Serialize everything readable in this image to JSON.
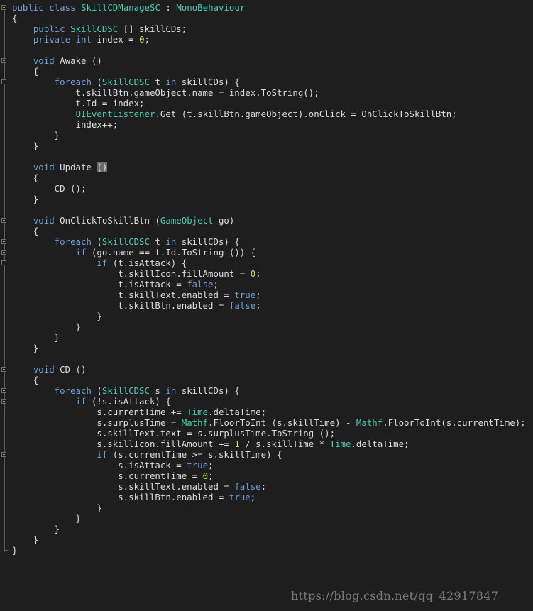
{
  "code_lines": [
    [
      [
        "kw",
        "public"
      ],
      [
        "t",
        " "
      ],
      [
        "kw",
        "class"
      ],
      [
        "t",
        " "
      ],
      [
        "ty",
        "SkillCDManageSC"
      ],
      [
        "t",
        " : "
      ],
      [
        "ty",
        "MonoBehaviour"
      ]
    ],
    [
      [
        "t",
        "{"
      ]
    ],
    [
      [
        "t",
        "    "
      ],
      [
        "kw",
        "public"
      ],
      [
        "t",
        " "
      ],
      [
        "ty",
        "SkillCDSC"
      ],
      [
        "t",
        " [] skillCDs;"
      ]
    ],
    [
      [
        "t",
        "    "
      ],
      [
        "kw",
        "private"
      ],
      [
        "t",
        " "
      ],
      [
        "kw",
        "int"
      ],
      [
        "t",
        " index = "
      ],
      [
        "num",
        "0"
      ],
      [
        "t",
        ";"
      ]
    ],
    [],
    [
      [
        "t",
        "    "
      ],
      [
        "kw",
        "void"
      ],
      [
        "t",
        " Awake ()"
      ]
    ],
    [
      [
        "t",
        "    {"
      ]
    ],
    [
      [
        "t",
        "        "
      ],
      [
        "kw",
        "foreach"
      ],
      [
        "t",
        " ("
      ],
      [
        "ty",
        "SkillCDSC"
      ],
      [
        "t",
        " t "
      ],
      [
        "kw",
        "in"
      ],
      [
        "t",
        " skillCDs) {"
      ]
    ],
    [
      [
        "t",
        "            t.skillBtn.gameObject.name = index.ToString();"
      ]
    ],
    [
      [
        "t",
        "            t.Id = index;"
      ]
    ],
    [
      [
        "t",
        "            "
      ],
      [
        "ty",
        "UIEventListener"
      ],
      [
        "t",
        ".Get (t.skillBtn.gameObject).onClick = OnClickToSkillBtn;"
      ]
    ],
    [
      [
        "t",
        "            index++;"
      ]
    ],
    [
      [
        "t",
        "        }"
      ]
    ],
    [
      [
        "t",
        "    }"
      ]
    ],
    [],
    [
      [
        "t",
        "    "
      ],
      [
        "kw",
        "void"
      ],
      [
        "t",
        " Update "
      ],
      [
        "hl",
        "()"
      ]
    ],
    [
      [
        "t",
        "    {"
      ]
    ],
    [
      [
        "t",
        "        CD ();"
      ]
    ],
    [
      [
        "t",
        "    }"
      ]
    ],
    [],
    [
      [
        "t",
        "    "
      ],
      [
        "kw",
        "void"
      ],
      [
        "t",
        " OnClickToSkillBtn ("
      ],
      [
        "ty",
        "GameObject"
      ],
      [
        "t",
        " go)"
      ]
    ],
    [
      [
        "t",
        "    {"
      ]
    ],
    [
      [
        "t",
        "        "
      ],
      [
        "kw",
        "foreach"
      ],
      [
        "t",
        " ("
      ],
      [
        "ty",
        "SkillCDSC"
      ],
      [
        "t",
        " t "
      ],
      [
        "kw",
        "in"
      ],
      [
        "t",
        " skillCDs) {"
      ]
    ],
    [
      [
        "t",
        "            "
      ],
      [
        "kw",
        "if"
      ],
      [
        "t",
        " (go.name == t.Id.ToString ()) {"
      ]
    ],
    [
      [
        "t",
        "                "
      ],
      [
        "kw",
        "if"
      ],
      [
        "t",
        " (t.isAttack) {"
      ]
    ],
    [
      [
        "t",
        "                    t.skillIcon.fillAmount = "
      ],
      [
        "num",
        "0"
      ],
      [
        "t",
        ";"
      ]
    ],
    [
      [
        "t",
        "                    t.isAttack = "
      ],
      [
        "kw",
        "false"
      ],
      [
        "t",
        ";"
      ]
    ],
    [
      [
        "t",
        "                    t.skillText.enabled = "
      ],
      [
        "kw",
        "true"
      ],
      [
        "t",
        ";"
      ]
    ],
    [
      [
        "t",
        "                    t.skillBtn.enabled = "
      ],
      [
        "kw",
        "false"
      ],
      [
        "t",
        ";"
      ]
    ],
    [
      [
        "t",
        "                }"
      ]
    ],
    [
      [
        "t",
        "            }"
      ]
    ],
    [
      [
        "t",
        "        }"
      ]
    ],
    [
      [
        "t",
        "    }"
      ]
    ],
    [],
    [
      [
        "t",
        "    "
      ],
      [
        "kw",
        "void"
      ],
      [
        "t",
        " CD ()"
      ]
    ],
    [
      [
        "t",
        "    {"
      ]
    ],
    [
      [
        "t",
        "        "
      ],
      [
        "kw",
        "foreach"
      ],
      [
        "t",
        " ("
      ],
      [
        "ty",
        "SkillCDSC"
      ],
      [
        "t",
        " s "
      ],
      [
        "kw",
        "in"
      ],
      [
        "t",
        " skillCDs) {"
      ]
    ],
    [
      [
        "t",
        "            "
      ],
      [
        "kw",
        "if"
      ],
      [
        "t",
        " (!s.isAttack) {"
      ]
    ],
    [
      [
        "t",
        "                s.currentTime += "
      ],
      [
        "ty",
        "Time"
      ],
      [
        "t",
        ".deltaTime;"
      ]
    ],
    [
      [
        "t",
        "                s.surplusTime = "
      ],
      [
        "ty",
        "Mathf"
      ],
      [
        "t",
        ".FloorToInt (s.skillTime) - "
      ],
      [
        "ty",
        "Mathf"
      ],
      [
        "t",
        ".FloorToInt(s.currentTime);"
      ]
    ],
    [
      [
        "t",
        "                s.skillText.text = s.surplusTime.ToString ();"
      ]
    ],
    [
      [
        "t",
        "                s.skillIcon.fillAmount += "
      ],
      [
        "num",
        "1"
      ],
      [
        "t",
        " / s.skillTime * "
      ],
      [
        "ty",
        "Time"
      ],
      [
        "t",
        ".deltaTime;"
      ]
    ],
    [
      [
        "t",
        "                "
      ],
      [
        "kw",
        "if"
      ],
      [
        "t",
        " (s.currentTime >= s.skillTime) {"
      ]
    ],
    [
      [
        "t",
        "                    s.isAttack = "
      ],
      [
        "kw",
        "true"
      ],
      [
        "t",
        ";"
      ]
    ],
    [
      [
        "t",
        "                    s.currentTime = "
      ],
      [
        "num",
        "0"
      ],
      [
        "t",
        ";"
      ]
    ],
    [
      [
        "t",
        "                    s.skillText.enabled = "
      ],
      [
        "kw",
        "false"
      ],
      [
        "t",
        ";"
      ]
    ],
    [
      [
        "t",
        "                    s.skillBtn.enabled = "
      ],
      [
        "kw",
        "true"
      ],
      [
        "t",
        ";"
      ]
    ],
    [
      [
        "t",
        "                }"
      ]
    ],
    [
      [
        "t",
        "            }"
      ]
    ],
    [
      [
        "t",
        "        }"
      ]
    ],
    [
      [
        "t",
        "    }"
      ]
    ],
    [
      [
        "t",
        "}"
      ]
    ]
  ],
  "fold_markers": [
    0,
    5,
    7,
    20,
    22,
    23,
    24,
    34,
    36,
    37,
    42
  ],
  "watermark": "https://blog.csdn.net/qq_42917847",
  "colors": {
    "background": "#1e1e1e",
    "text": "#dcdcdc",
    "keyword": "#6f9fd8",
    "type": "#4ec9b0",
    "number": "#b5e853",
    "bracket_highlight": "#6b6b6b"
  }
}
